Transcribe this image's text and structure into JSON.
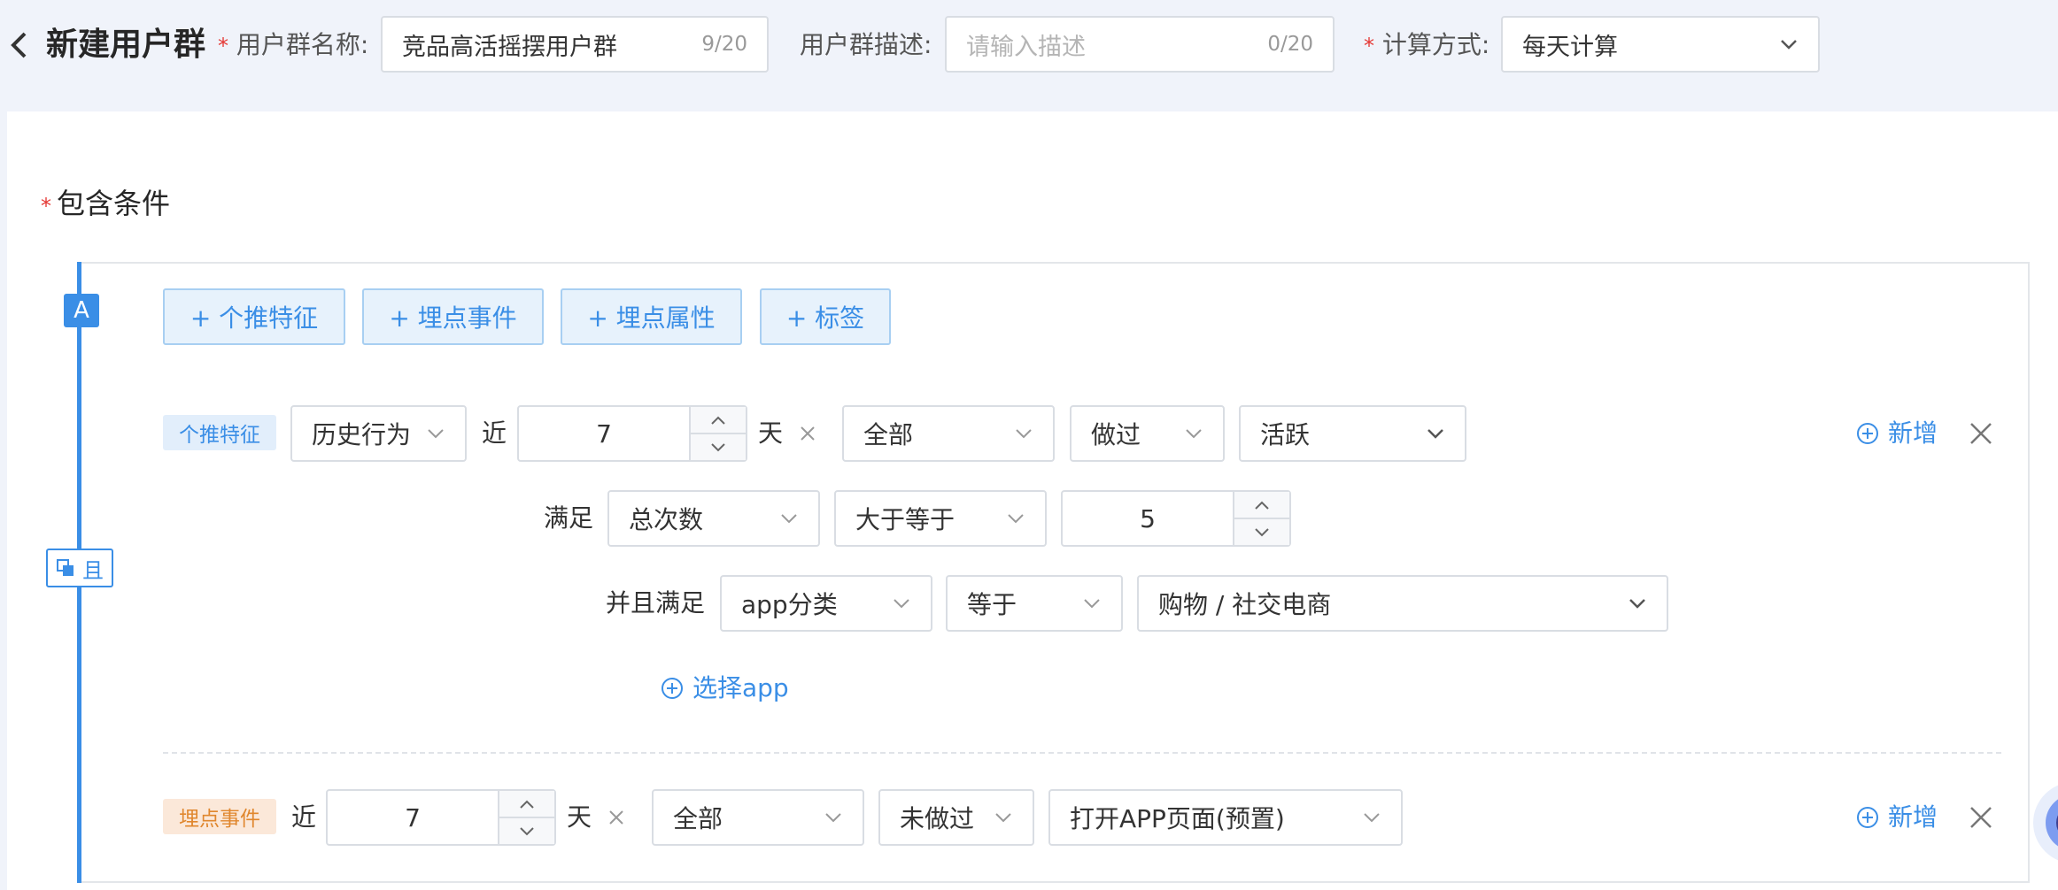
{
  "header": {
    "title": "新建用户群",
    "name_label": "用户群名称:",
    "name_value": "竞品高活摇摆用户群",
    "name_count": "9/20",
    "desc_label": "用户群描述:",
    "desc_placeholder": "请输入描述",
    "desc_count": "0/20",
    "calc_label": "计算方式:",
    "calc_value": "每天计算",
    "required_mark": "*"
  },
  "section": {
    "title": "包含条件",
    "group_badge": "A",
    "logic_label": "且"
  },
  "add_buttons": [
    "+ 个推特征",
    "+ 埋点事件",
    "+ 埋点属性",
    "+ 标签"
  ],
  "rule1": {
    "tag": "个推特征",
    "behavior": "历史行为",
    "near": "近",
    "days": "7",
    "day_unit": "天",
    "scope": "全部",
    "action": "做过",
    "state": "活跃",
    "add_label": "新增",
    "satisfy_label": "满足",
    "metric": "总次数",
    "operator": "大于等于",
    "threshold": "5",
    "and_satisfy_label": "并且满足",
    "field": "app分类",
    "field_op": "等于",
    "field_value": "购物 / 社交电商",
    "select_app": "选择app"
  },
  "rule2": {
    "tag": "埋点事件",
    "near": "近",
    "days": "7",
    "day_unit": "天",
    "scope": "全部",
    "action": "未做过",
    "event": "打开APP页面(预置)",
    "add_label": "新增"
  },
  "colors": {
    "accent": "#3a8ee6",
    "required": "#e53935",
    "tag_orange": "#e0872e"
  }
}
